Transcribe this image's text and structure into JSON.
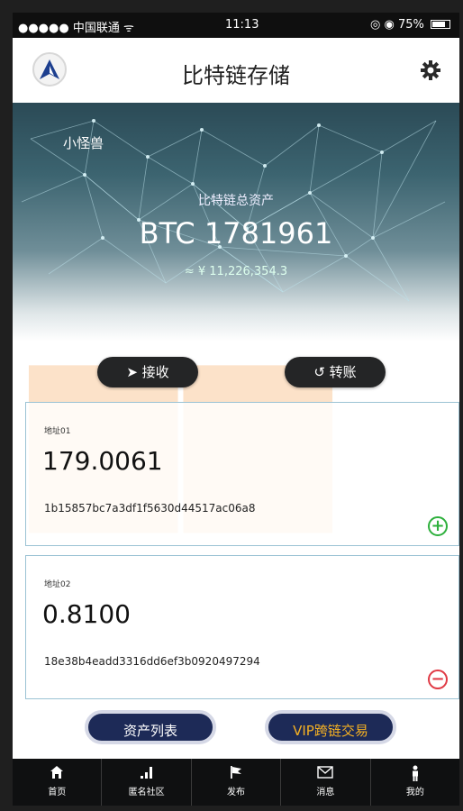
{
  "status_bar": {
    "carrier": "●●●●● 中国联通 ᯤ",
    "time": "11:13",
    "battery": "◎ ◉ 75%"
  },
  "header": {
    "title": "比特链存储",
    "logo_icon": "app-logo-icon",
    "settings_icon": "gear-icon"
  },
  "hero": {
    "nickname": "小怪兽",
    "asset_label": "比特链总资产",
    "asset_value": "BTC 1781961",
    "asset_cny": "≈ ¥ 11,226,354.3"
  },
  "actions": {
    "receive_label": "➤ 接收",
    "transfer_label": "↺ 转账"
  },
  "addresses": [
    {
      "label": "地址01",
      "amount": "179.0061",
      "address": "1b15857bc7a3df1f5630d44517ac06a8",
      "action_icon": "plus-circle-icon"
    },
    {
      "label": "地址02",
      "amount": "0.8100",
      "address": "18e38b4eadd3316dd6ef3b0920497294",
      "action_icon": "minus-circle-icon"
    }
  ],
  "bottom_buttons": {
    "asset_list": "资产列表",
    "vip": "VIP跨链交易"
  },
  "tabs": [
    {
      "label": "首页",
      "icon": "home-icon"
    },
    {
      "label": "匿名社区",
      "icon": "signal-icon"
    },
    {
      "label": "发布",
      "icon": "flag-icon"
    },
    {
      "label": "消息",
      "icon": "mail-icon"
    },
    {
      "label": "我的",
      "icon": "person-icon"
    }
  ],
  "colors": {
    "accent_navy": "#1d2a57",
    "vip_gold": "#f4b023",
    "plus_green": "#2db03c",
    "minus_red": "#e03a45",
    "card_border": "#9bc3d4"
  }
}
